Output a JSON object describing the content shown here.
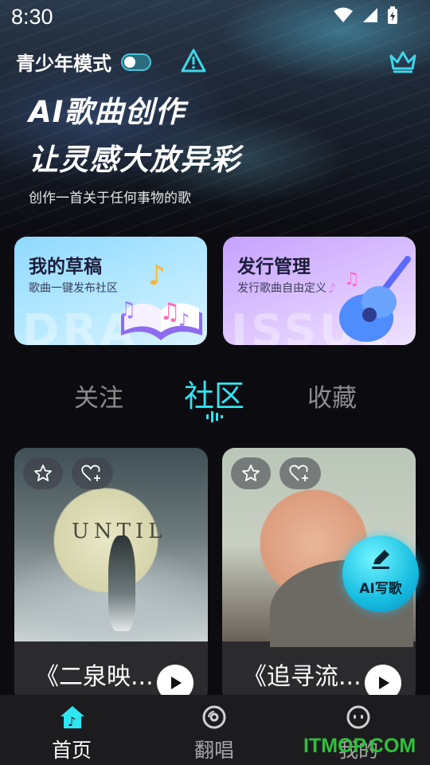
{
  "status_bar": {
    "time": "8:30"
  },
  "header": {
    "teen_mode_label": "青少年模式",
    "title_line1": "AI歌曲创作",
    "title_line2": "让灵感大放异彩",
    "subtitle": "创作一首关于任何事物的歌"
  },
  "cards": [
    {
      "title": "我的草稿",
      "desc": "歌曲一键发布社区",
      "watermark": "DRA"
    },
    {
      "title": "发行管理",
      "desc": "发行歌曲自由定义",
      "watermark": "ISSUE"
    }
  ],
  "tabs": {
    "follow": "关注",
    "community": "社区",
    "favorite": "收藏"
  },
  "songs": [
    {
      "title": "《二泉映...",
      "cover_text": "UNTIL"
    },
    {
      "title": "《追寻流..."
    }
  ],
  "fab": {
    "label": "AI写歌"
  },
  "bottom_nav": {
    "home": "首页",
    "cover": "翻唱",
    "mine": "我的"
  },
  "site_watermark": "ITMOP.COM",
  "colors": {
    "accent": "#2ee6f2",
    "nav_bg": "#1c1c1f"
  }
}
